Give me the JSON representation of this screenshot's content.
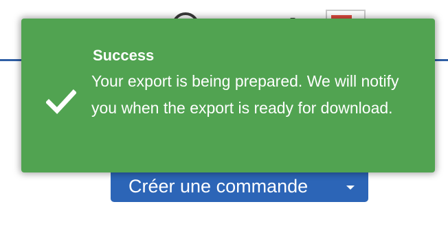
{
  "toast": {
    "title": "Success",
    "message": "Your export is being prepared. We will notify you when the export is ready for download.",
    "icon": "checkmark-icon",
    "color": "#51a351"
  },
  "background": {
    "create_order_label": "Créer une commande",
    "create_order_color": "#2c65b7",
    "header_line_color": "#2f5fa5"
  }
}
